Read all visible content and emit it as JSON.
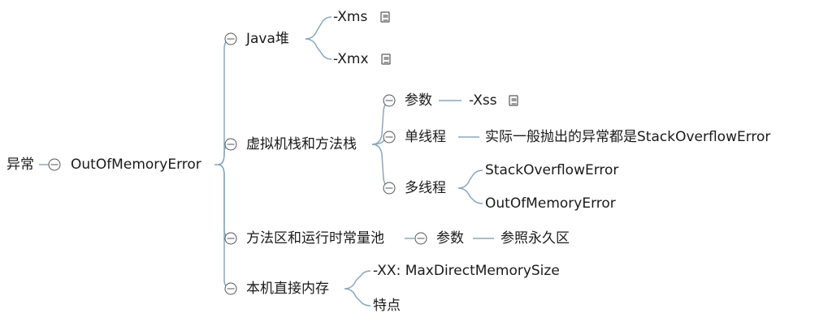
{
  "mindmap": {
    "root": "异常",
    "oom": "OutOfMemoryError",
    "heap": {
      "label": "Java堆",
      "xms": "-Xms",
      "xmx": "-Xmx"
    },
    "stack": {
      "label": "虚拟机栈和方法栈",
      "params": "参数",
      "xss": "-Xss",
      "single": "单线程",
      "single_detail": "实际一般抛出的异常都是StackOverflowError",
      "multi": "多线程",
      "multi_a": "StackOverflowError",
      "multi_b": "OutOfMemoryError"
    },
    "method_area": {
      "label": "方法区和运行时常量池",
      "params": "参数",
      "perm": "参照永久区"
    },
    "direct": {
      "label": "本机直接内存",
      "size": "-XX: MaxDirectMemorySize",
      "features": "特点"
    },
    "line_color": "#8aa8bb"
  }
}
